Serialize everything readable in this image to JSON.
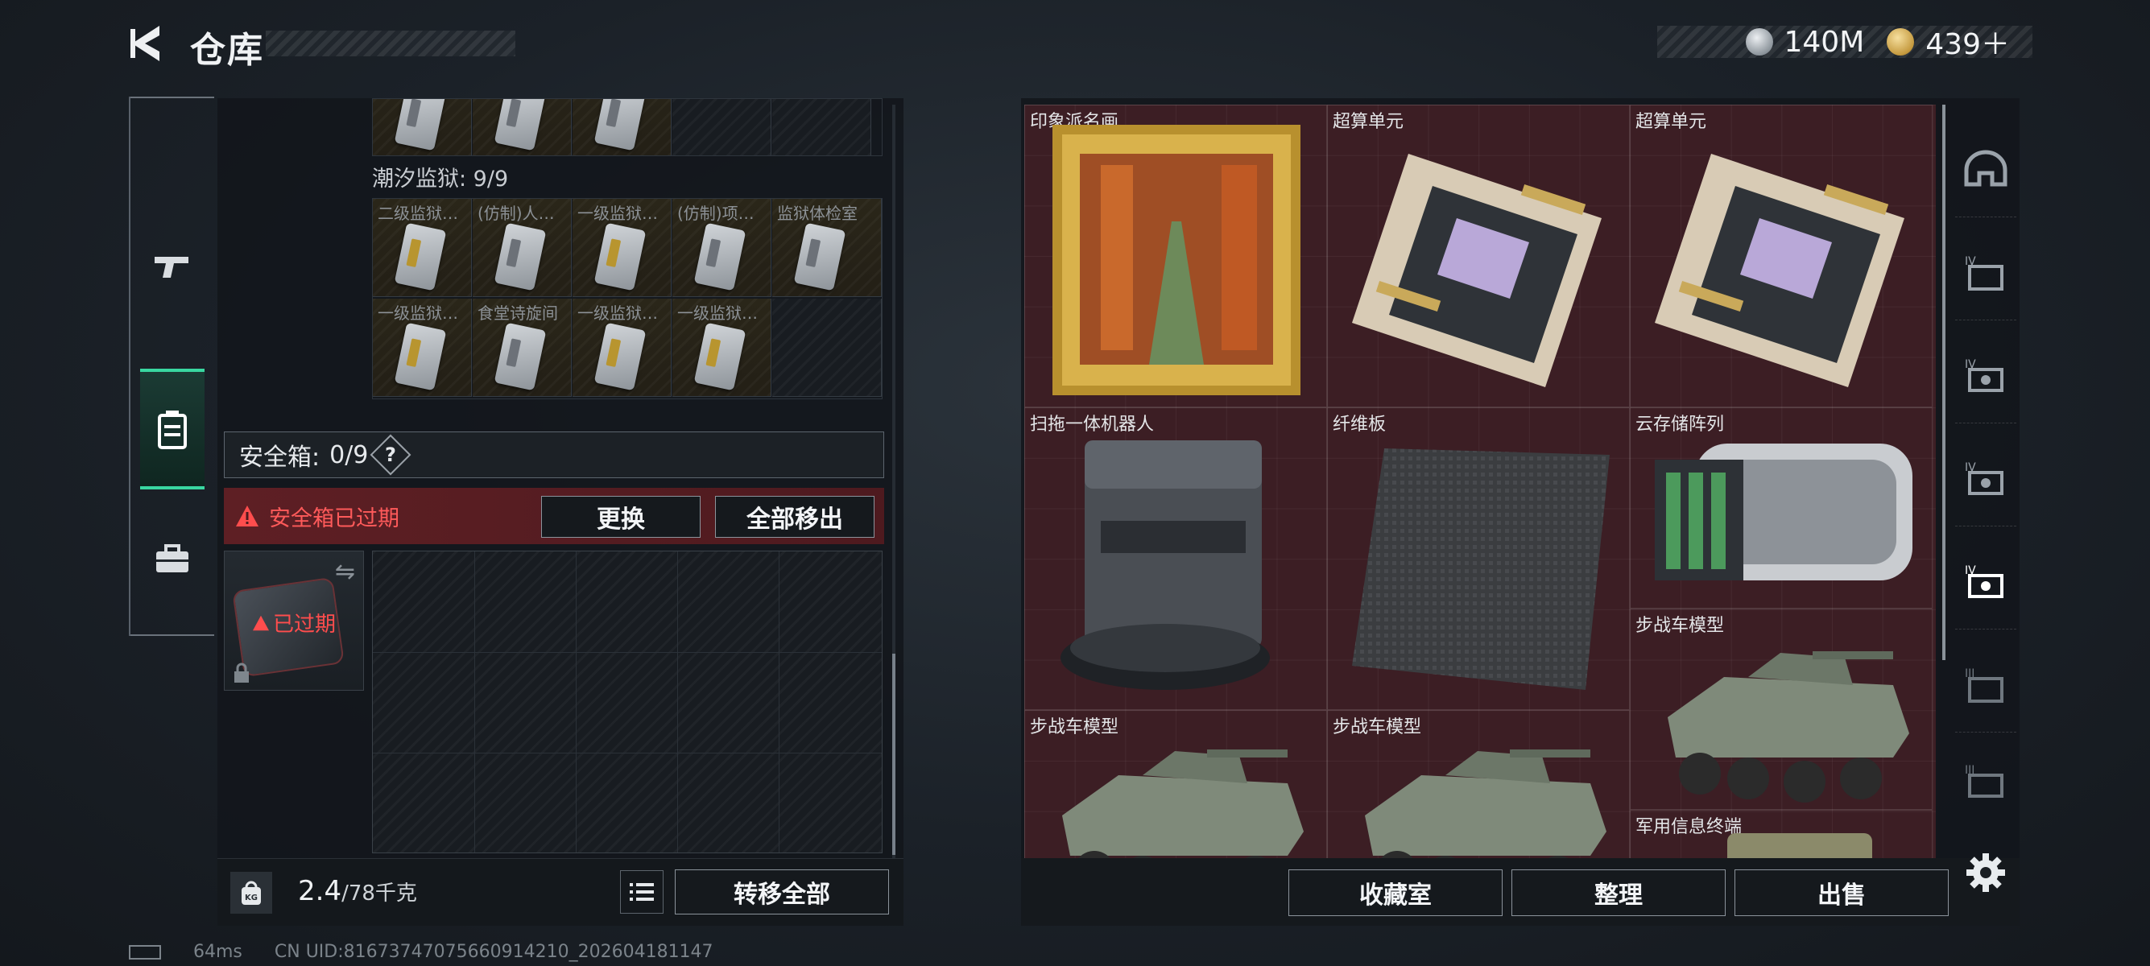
{
  "header": {
    "title": "仓库",
    "currencies": [
      {
        "icon": "silver-coin-icon",
        "value": "140M"
      },
      {
        "icon": "gold-coin-icon",
        "value": "439＋"
      }
    ]
  },
  "left_nav": {
    "items": [
      {
        "icon": "rifle-icon",
        "active": false
      },
      {
        "icon": "backpack-icon",
        "active": false
      },
      {
        "icon": "safebox-icon",
        "active": true
      },
      {
        "icon": "briefcase-icon",
        "active": false
      }
    ]
  },
  "container": {
    "section_label": "潮汐监狱: 9/9",
    "row1": [
      {
        "label": "二级监狱…",
        "card": "gold"
      },
      {
        "label": "(仿制)人…",
        "card": "grey"
      },
      {
        "label": "一级监狱…",
        "card": "gold"
      },
      {
        "label": "(仿制)项…",
        "card": "grey"
      },
      {
        "label": "监狱体检室",
        "card": "grey"
      }
    ],
    "row2": [
      {
        "label": "一级监狱…",
        "card": "gold"
      },
      {
        "label": "食堂诗旋间",
        "card": "grey"
      },
      {
        "label": "一级监狱…",
        "card": "gold"
      },
      {
        "label": "一级监狱…",
        "card": "gold"
      }
    ]
  },
  "safebox": {
    "label": "安全箱:",
    "count": "0/9",
    "help": "?",
    "expired_banner": "安全箱已过期",
    "replace_btn": "更换",
    "remove_all_btn": "全部移出",
    "item_status": "已过期"
  },
  "footer_left": {
    "weight_value": "2.4",
    "weight_cap": "/78千克",
    "weight_icon_label": "KG",
    "transfer_btn": "转移全部"
  },
  "stash": {
    "items": [
      {
        "name": "印象派名画",
        "kind": "painting"
      },
      {
        "name": "超算单元",
        "kind": "board"
      },
      {
        "name": "超算单元",
        "kind": "board"
      },
      {
        "name": "扫拖一体机器人",
        "kind": "robot"
      },
      {
        "name": "纤维板",
        "kind": "fiber"
      },
      {
        "name": "云存储阵列",
        "kind": "storage"
      },
      {
        "name": "步战车模型",
        "kind": "tank"
      },
      {
        "name": "步战车模型",
        "kind": "tank"
      },
      {
        "name": "步战车模型",
        "kind": "tank"
      },
      {
        "name": "军用信息终端",
        "kind": "terminal"
      }
    ]
  },
  "footer_right": {
    "collection_btn": "收藏室",
    "sort_btn": "整理",
    "sell_btn": "出售"
  },
  "right_nav": {
    "items": [
      "helmet-icon",
      "tier4-case-icon",
      "tier4-tool-icon",
      "tier4-tool-icon",
      "tier4-tool-icon",
      "tier3-case-icon",
      "tier3-tool-icon"
    ]
  },
  "status": {
    "ping": "64ms",
    "uid": "CN UID:8167374707566091421​0_202604181147"
  },
  "colors": {
    "accent_green": "#39d7a1",
    "warning_red": "#ff5a5a",
    "stash_bg": "#3c1e24"
  }
}
